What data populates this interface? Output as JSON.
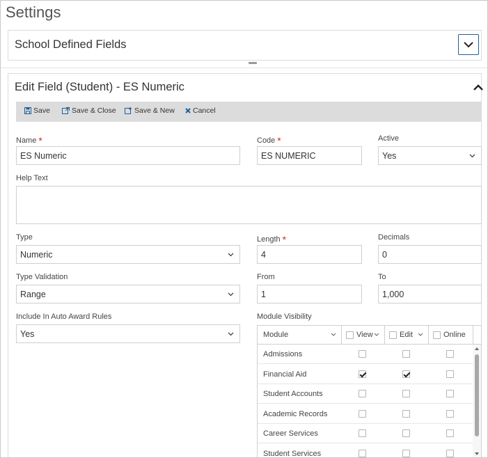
{
  "page": {
    "title": "Settings"
  },
  "collapsed_panel": {
    "title": "School Defined Fields"
  },
  "edit_panel": {
    "title": "Edit Field (Student) - ES Numeric"
  },
  "toolbar": {
    "save_label": "Save",
    "save_close_label": "Save & Close",
    "save_new_label": "Save & New",
    "cancel_label": "Cancel"
  },
  "form": {
    "name": {
      "label": "Name",
      "value": "ES Numeric"
    },
    "code": {
      "label": "Code",
      "value": "ES NUMERIC"
    },
    "active": {
      "label": "Active",
      "value": "Yes"
    },
    "help_text": {
      "label": "Help Text",
      "value": ""
    },
    "type": {
      "label": "Type",
      "value": "Numeric"
    },
    "length": {
      "label": "Length",
      "value": "4"
    },
    "decimals": {
      "label": "Decimals",
      "value": "0"
    },
    "type_validation": {
      "label": "Type Validation",
      "value": "Range"
    },
    "from": {
      "label": "From",
      "value": "1"
    },
    "to": {
      "label": "To",
      "value": "1,000"
    },
    "auto_award": {
      "label": "Include In Auto Award Rules",
      "value": "Yes"
    },
    "required_marker": "*"
  },
  "module_visibility": {
    "label": "Module Visibility",
    "columns": {
      "module": "Module",
      "view": "View",
      "edit": "Edit",
      "online": "Online"
    },
    "rows": [
      {
        "module": "Admissions",
        "view": false,
        "edit": false,
        "online": false
      },
      {
        "module": "Financial Aid",
        "view": true,
        "edit": true,
        "online": false
      },
      {
        "module": "Student Accounts",
        "view": false,
        "edit": false,
        "online": false
      },
      {
        "module": "Academic Records",
        "view": false,
        "edit": false,
        "online": false
      },
      {
        "module": "Career Services",
        "view": false,
        "edit": false,
        "online": false
      },
      {
        "module": "Student Services",
        "view": false,
        "edit": false,
        "online": false
      }
    ]
  },
  "colors": {
    "required": "#d8232a",
    "toolbar_bg": "#dcdcdc",
    "icon_blue": "#1f5f9a"
  }
}
